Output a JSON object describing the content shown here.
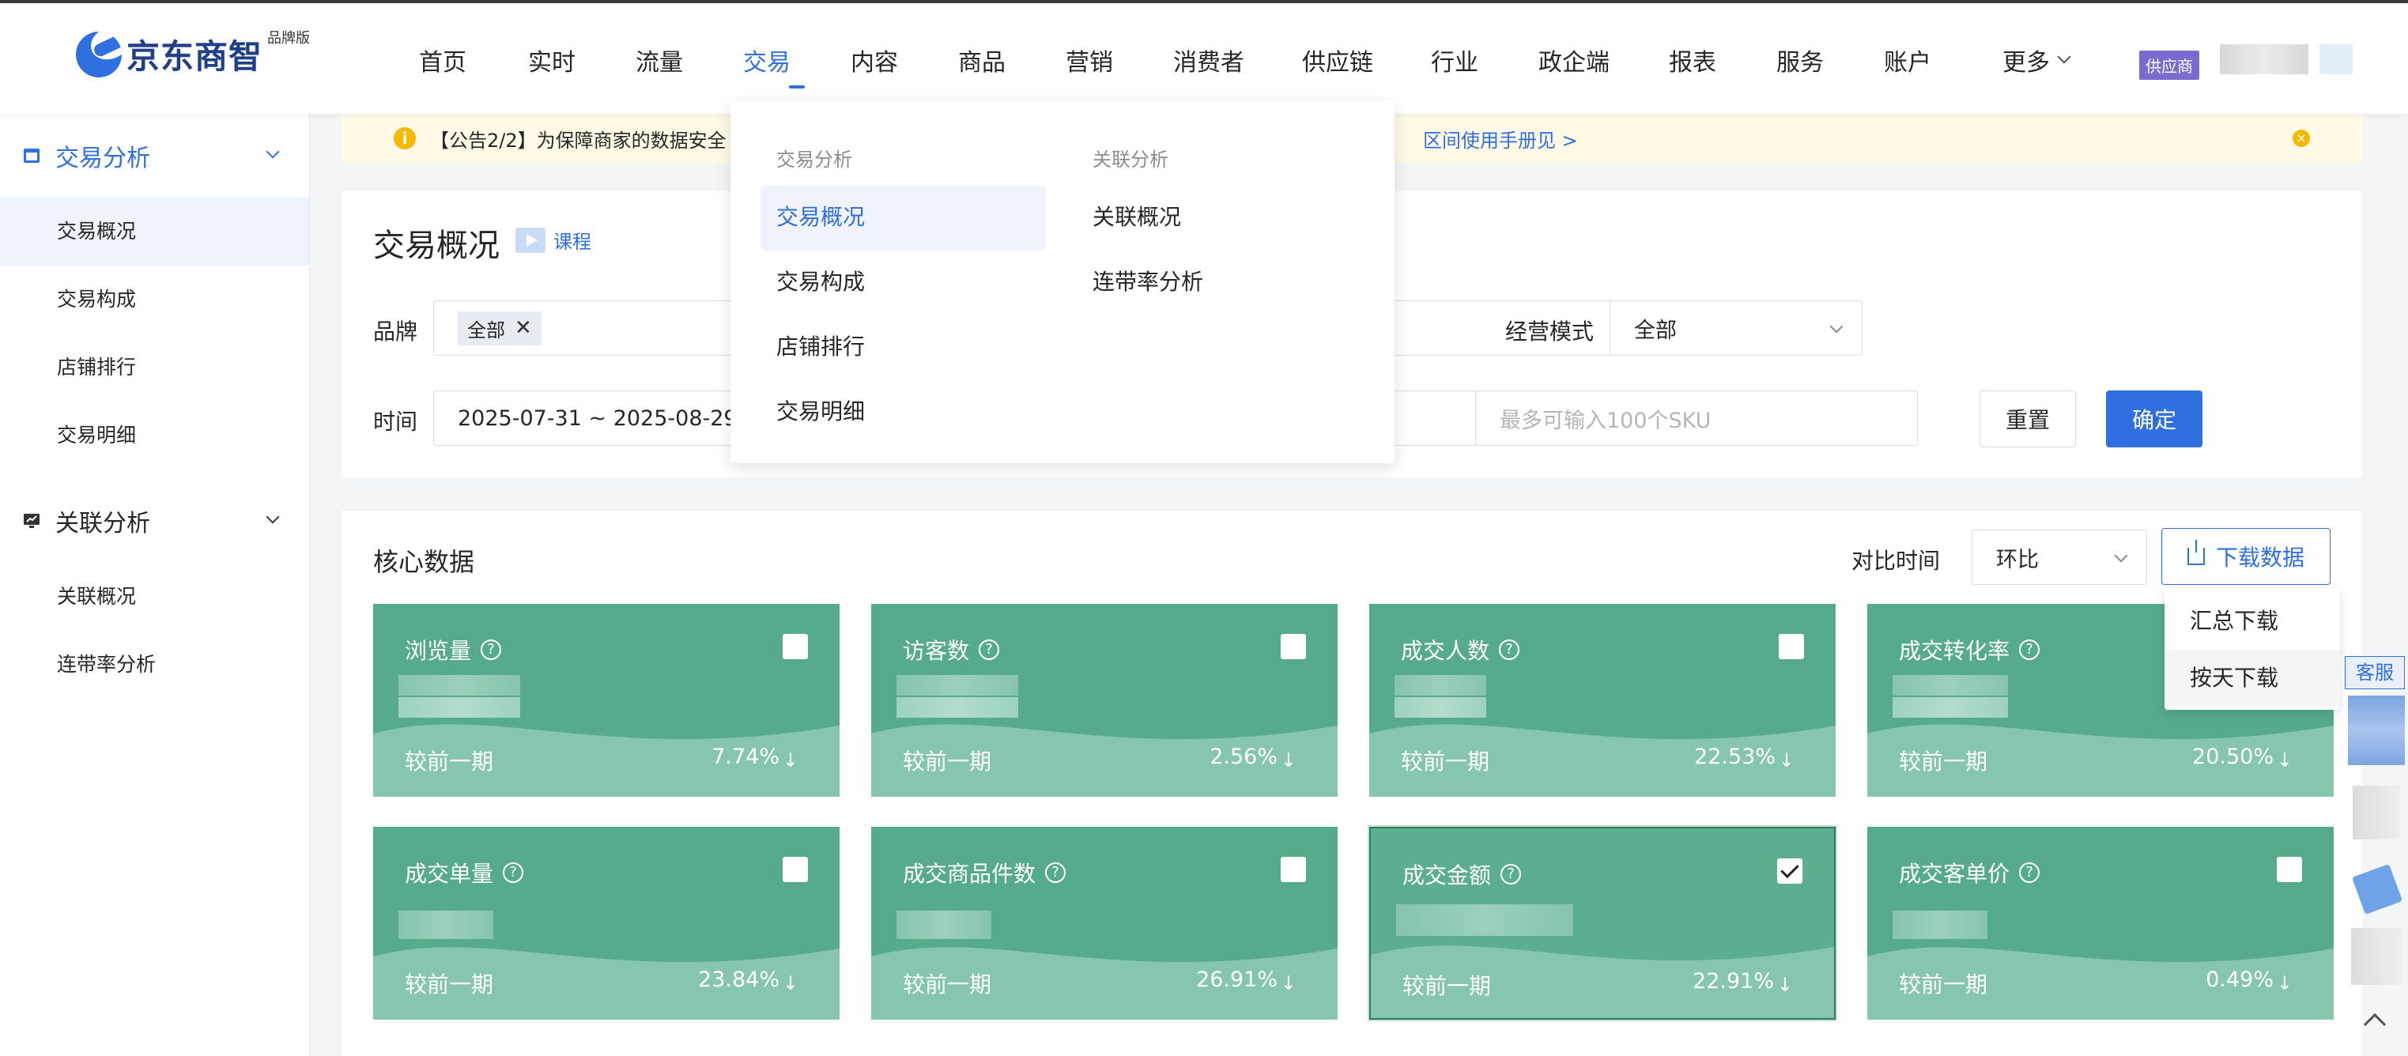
{
  "app": {
    "brand": "京东商智",
    "edition": "品牌版",
    "role_badge": "供应商"
  },
  "nav": [
    "首页",
    "实时",
    "流量",
    "交易",
    "内容",
    "商品",
    "营销",
    "消费者",
    "供应链",
    "行业",
    "政企端",
    "报表",
    "服务",
    "账户"
  ],
  "nav_more": "更多",
  "nav_active": "交易",
  "sidebar": {
    "group1": "交易分析",
    "group1_items": [
      "交易概况",
      "交易构成",
      "店铺排行",
      "交易明细"
    ],
    "group2": "关联分析",
    "group2_items": [
      "关联概况",
      "连带率分析"
    ]
  },
  "notice": {
    "text": "【公告2/2】为保障商家的数据安全",
    "link": "区间使用手册见 >"
  },
  "page": {
    "title": "交易概况",
    "course": "课程"
  },
  "filters": {
    "brand_label": "品牌",
    "brand_tag": "全部",
    "mode_label": "经营模式",
    "mode_value": "全部",
    "time_label": "时间",
    "time_value": "2025-07-31 ~ 2025-08-29",
    "sku_placeholder": "最多可输入100个SKU",
    "reset": "重置",
    "confirm": "确定"
  },
  "core": {
    "title": "核心数据",
    "compare_label": "对比时间",
    "compare_value": "环比",
    "download": "下载数据",
    "download_menu": [
      "汇总下载",
      "按天下载"
    ],
    "prev_label": "较前一期",
    "cards": [
      {
        "name": "浏览量",
        "pct": "7.74%",
        "checked": false
      },
      {
        "name": "访客数",
        "pct": "2.56%",
        "checked": false
      },
      {
        "name": "成交人数",
        "pct": "22.53%",
        "checked": false
      },
      {
        "name": "成交转化率",
        "pct": "20.50%",
        "checked": false
      },
      {
        "name": "成交单量",
        "pct": "23.84%",
        "checked": false
      },
      {
        "name": "成交商品件数",
        "pct": "26.91%",
        "checked": false
      },
      {
        "name": "成交金额",
        "pct": "22.91%",
        "checked": true
      },
      {
        "name": "成交客单价",
        "pct": "0.49%",
        "checked": false
      }
    ]
  },
  "mega_menu": {
    "col1_head": "交易分析",
    "col1_items": [
      "交易概况",
      "交易构成",
      "店铺排行",
      "交易明细"
    ],
    "col2_head": "关联分析",
    "col2_items": [
      "关联概况",
      "连带率分析"
    ]
  },
  "kefu": "客服",
  "colors": {
    "primary": "#2f6fe0",
    "card_green": "#56ab8c",
    "notice_bg": "#fff9e6"
  }
}
